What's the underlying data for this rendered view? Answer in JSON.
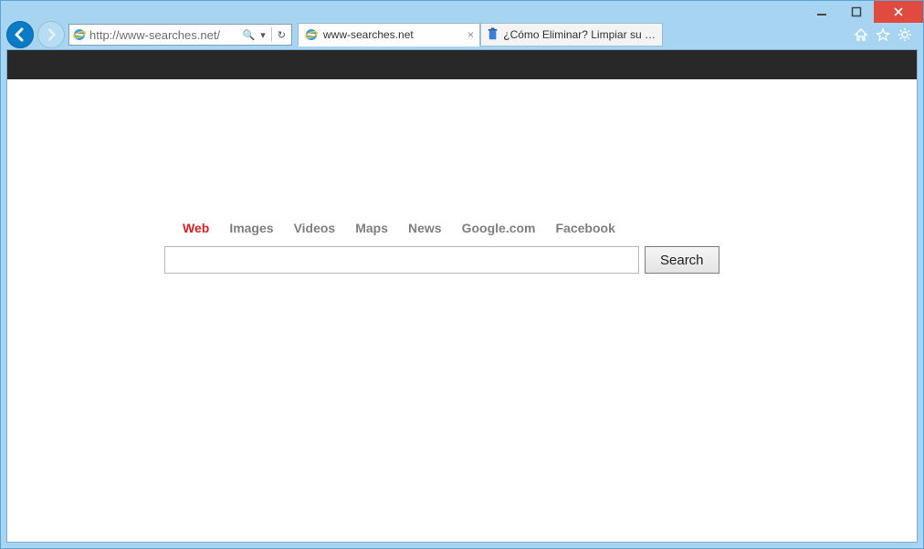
{
  "window": {
    "minimize": "—",
    "close": "✕"
  },
  "address": {
    "url": "http://www-searches.net/",
    "search_glyph": "🔍",
    "dropdown_glyph": "▾",
    "refresh_glyph": "↻"
  },
  "tabs": [
    {
      "label": "www-searches.net",
      "icon": "ie",
      "close": "×"
    },
    {
      "label": "¿Cómo Eliminar? Limpiar su co...",
      "icon": "trash",
      "close": ""
    }
  ],
  "page": {
    "categories": [
      "Web",
      "Images",
      "Videos",
      "Maps",
      "News",
      "Google.com",
      "Facebook"
    ],
    "active_category_index": 0,
    "search_value": "",
    "search_button": "Search"
  }
}
